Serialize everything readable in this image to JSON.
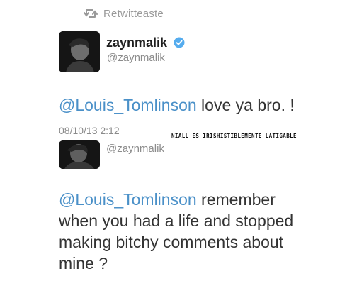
{
  "retweet": {
    "label": "Retwitteaste",
    "icon": "retweet-icon"
  },
  "tweet1": {
    "display_name": "zaynmalik",
    "handle": "@zaynmalik",
    "verified_icon": "verified-badge-icon",
    "mention": "@Louis_Tomlinson",
    "text": " love ya bro. !",
    "timestamp": "08/10/13 2:12"
  },
  "overlay_caption": "NIALL ES IRISHISTIBLEMENTE LATIGABLE",
  "tweet2": {
    "handle": "@zaynmalik",
    "mention": "@Louis_Tomlinson",
    "text_line1": " remember",
    "text_line2": "when you had a life and stopped",
    "text_line3": "making bitchy comments about",
    "text_line4": "mine ?"
  },
  "colors": {
    "mention_blue": "#4a90c8",
    "verified_blue": "#55acee"
  }
}
